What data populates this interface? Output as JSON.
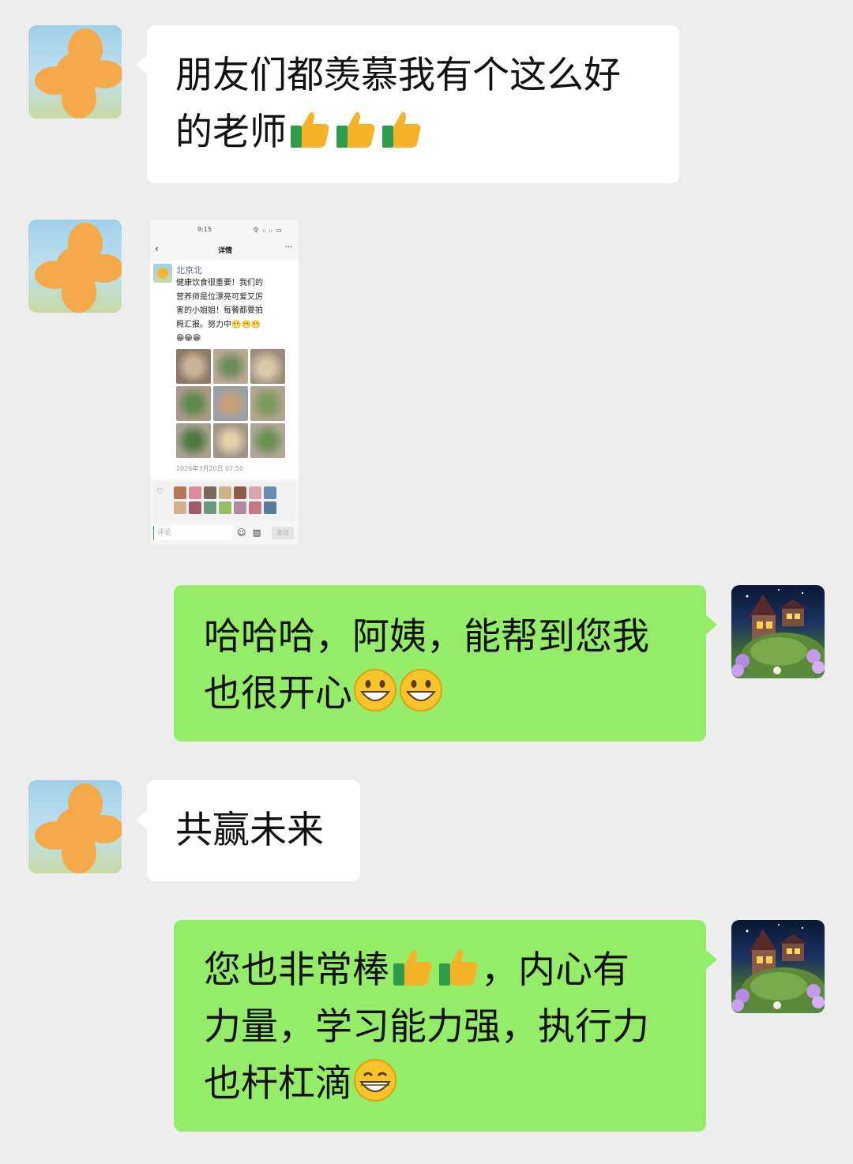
{
  "chat": {
    "messages": [
      {
        "side": "left",
        "type": "text",
        "text": "朋友们都羡慕我有个这么好的老师",
        "emojis": [
          "thumbs-up",
          "thumbs-up",
          "thumbs-up"
        ]
      },
      {
        "side": "left",
        "type": "image"
      },
      {
        "side": "right",
        "type": "text",
        "text": "哈哈哈，阿姨，能帮到您我也很开心",
        "emojis": [
          "grinning-face",
          "grinning-face"
        ]
      },
      {
        "side": "left",
        "type": "text",
        "text": "共赢未来"
      },
      {
        "side": "right",
        "type": "text",
        "text": "您也非常棒，内心有力量，学习能力强，执行力也杆杠滴",
        "emojis": [
          "thumbs-up",
          "thumbs-up",
          "grinning-face"
        ]
      }
    ]
  },
  "m1": {
    "line1": "朋友们都羡慕我有个这么好",
    "line2": "的老师"
  },
  "m3": {
    "line1": "哈哈哈，阿姨，能帮到您我",
    "line2": "也很开心"
  },
  "m4": {
    "text": "共赢未来"
  },
  "m5": {
    "line1a": "您也非常棒",
    "line1b": "，内心有",
    "line2": "力量，学习能力强，执行力",
    "line3": "也杆杠滴"
  },
  "screenshot": {
    "status_time": "9:15",
    "status_icons": "令 ᵢₗ ᵢₗ ▭",
    "back": "‹",
    "title": "详情",
    "more": "···",
    "username": "北京北",
    "post_lines": [
      "健康饮食很重要！我们的",
      "营养师是位漂亮可爱又厉",
      "害的小姐姐！每餐都要拍",
      "照汇报。努力中😬😬😬",
      "😁😁😁"
    ],
    "timestamp": "2026年3月20日 07:50",
    "comment_placeholder": "评论",
    "send_label": "发送"
  },
  "colors": {
    "background": "#ededed",
    "bubble_white": "#ffffff",
    "bubble_green": "#95ec69",
    "link_blue": "#576b95"
  }
}
